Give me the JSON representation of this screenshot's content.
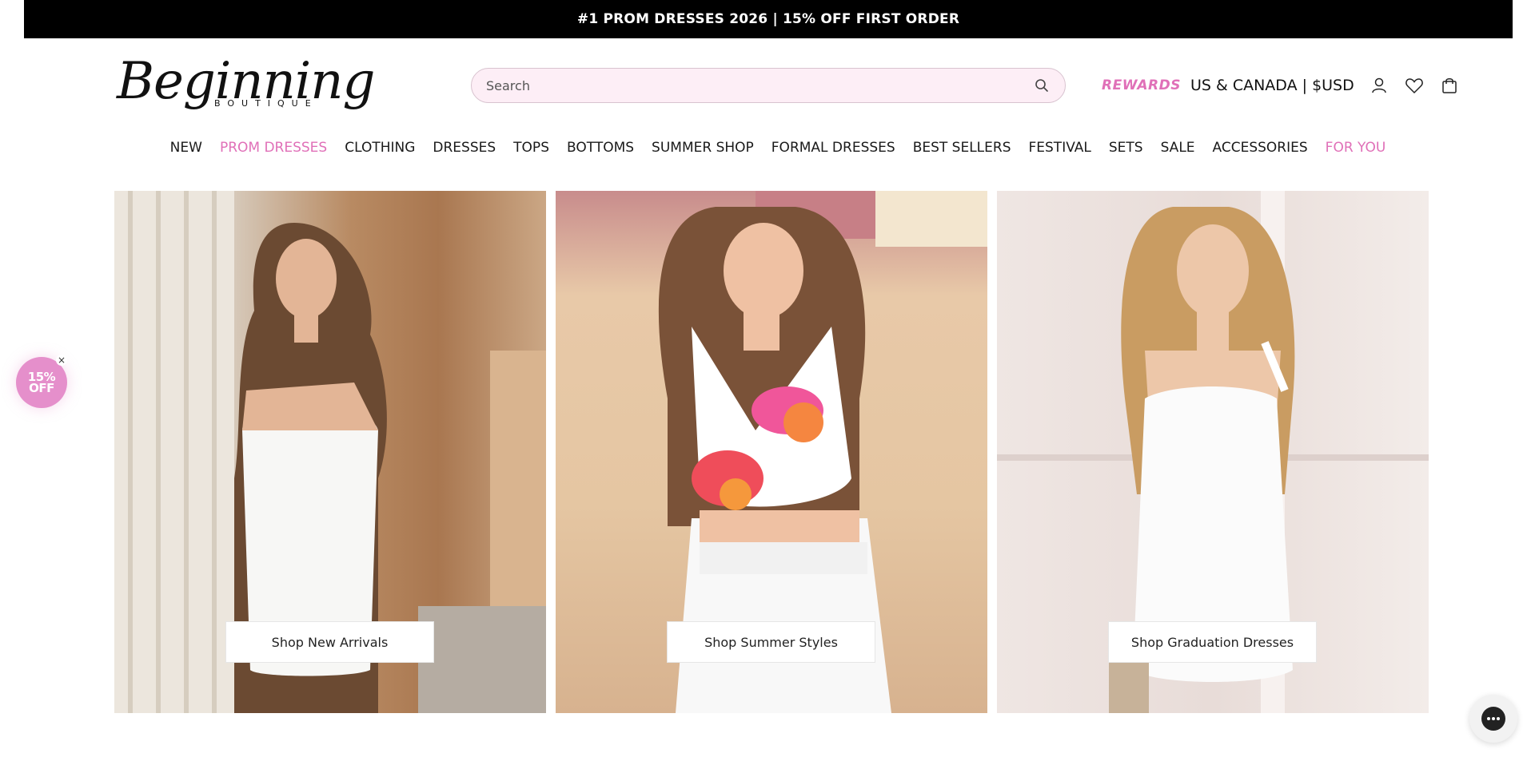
{
  "announcement": "#1 PROM DRESSES 2026 | 15% OFF FIRST ORDER",
  "logo": {
    "main": "Beginning",
    "sub": "BOUTIQUE"
  },
  "search": {
    "placeholder": "Search",
    "icon": "search-icon"
  },
  "header": {
    "rewards": "REWARDS",
    "region": "US & CANADA | $USD",
    "icons": [
      "account-icon",
      "wishlist-heart-icon",
      "cart-bag-icon"
    ]
  },
  "nav": {
    "items": [
      {
        "label": "NEW"
      },
      {
        "label": "PROM DRESSES",
        "highlight": true
      },
      {
        "label": "CLOTHING"
      },
      {
        "label": "DRESSES"
      },
      {
        "label": "TOPS"
      },
      {
        "label": "BOTTOMS"
      },
      {
        "label": "SUMMER SHOP"
      },
      {
        "label": "FORMAL DRESSES"
      },
      {
        "label": "BEST SELLERS"
      },
      {
        "label": "FESTIVAL"
      },
      {
        "label": "SETS"
      },
      {
        "label": "SALE"
      },
      {
        "label": "ACCESSORIES"
      },
      {
        "label": "FOR YOU",
        "highlight": true
      }
    ]
  },
  "heroes": [
    {
      "cta": "Shop New Arrivals"
    },
    {
      "cta": "Shop Summer Styles"
    },
    {
      "cta": "Shop Graduation Dresses"
    }
  ],
  "promo": {
    "line1": "15%",
    "line2": "OFF",
    "close": "×"
  },
  "colors": {
    "accent_pink": "#e070b8",
    "search_bg": "#fdeef6",
    "announcement_bg": "#000000"
  }
}
